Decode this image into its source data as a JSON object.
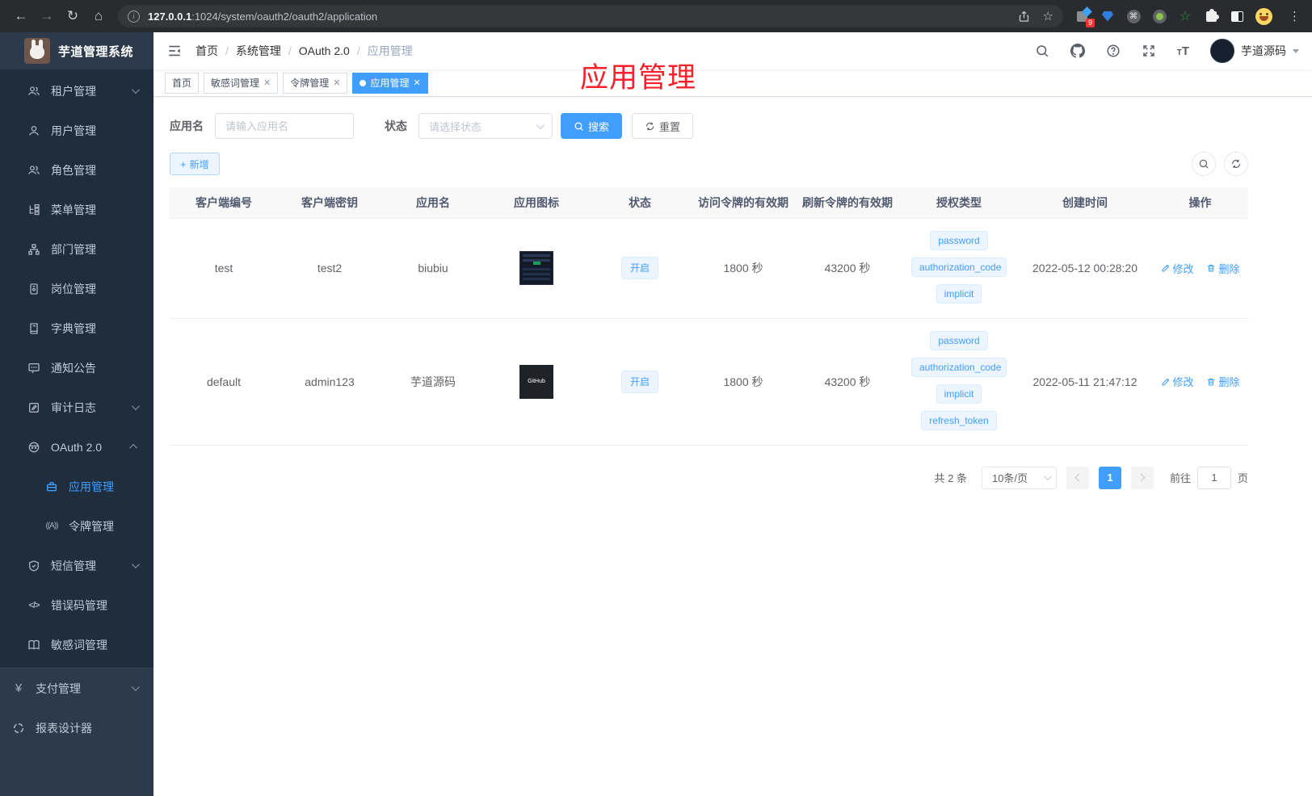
{
  "browser": {
    "url_host": "127.0.0.1",
    "url_path": ":1024/system/oauth2/oauth2/application",
    "ext_badge": "9"
  },
  "sidebar": {
    "logo_title": "芋道管理系统",
    "items": [
      {
        "label": "租户管理",
        "icon": "users-icon",
        "arrow": "down"
      },
      {
        "label": "用户管理",
        "icon": "user-icon"
      },
      {
        "label": "角色管理",
        "icon": "role-users-icon"
      },
      {
        "label": "菜单管理",
        "icon": "menu-tree-icon"
      },
      {
        "label": "部门管理",
        "icon": "org-tree-icon"
      },
      {
        "label": "岗位管理",
        "icon": "post-badge-icon"
      },
      {
        "label": "字典管理",
        "icon": "dictionary-icon"
      },
      {
        "label": "通知公告",
        "icon": "notice-icon"
      },
      {
        "label": "审计日志",
        "icon": "audit-log-icon",
        "arrow": "down"
      },
      {
        "label": "OAuth 2.0",
        "icon": "oauth-robot-icon",
        "arrow": "up"
      },
      {
        "label": "应用管理",
        "icon": "app-briefcase-icon",
        "active": true
      },
      {
        "label": "令牌管理",
        "icon": "token-icon"
      },
      {
        "label": "短信管理",
        "icon": "sms-shield-icon",
        "arrow": "down"
      },
      {
        "label": "错误码管理",
        "icon": "errorcode-icon"
      },
      {
        "label": "敏感词管理",
        "icon": "sensitive-word-icon"
      },
      {
        "label": "支付管理",
        "icon": "pay-yen-icon",
        "arrow": "down"
      },
      {
        "label": "报表设计器",
        "icon": "report-designer-icon"
      }
    ]
  },
  "header": {
    "breadcrumb": [
      "首页",
      "系统管理",
      "OAuth 2.0",
      "应用管理"
    ],
    "breadcrumb_separator": "/",
    "username": "芋道源码"
  },
  "annotation": {
    "text": "应用管理",
    "color": "#f5222d"
  },
  "tabs": [
    {
      "label": "首页",
      "closable": false
    },
    {
      "label": "敏感词管理",
      "closable": true
    },
    {
      "label": "令牌管理",
      "closable": true
    },
    {
      "label": "应用管理",
      "closable": true,
      "active": true
    }
  ],
  "filters": {
    "name_label": "应用名",
    "name_placeholder": "请输入应用名",
    "status_label": "状态",
    "status_placeholder": "请选择状态",
    "search_label": "搜索",
    "reset_label": "重置"
  },
  "toolbar": {
    "add_label": "新增"
  },
  "table": {
    "headers": [
      "客户端编号",
      "客户端密钥",
      "应用名",
      "应用图标",
      "状态",
      "访问令牌的有效期",
      "刷新令牌的有效期",
      "授权类型",
      "创建时间",
      "操作"
    ],
    "rows": [
      {
        "client_id": "test",
        "client_secret": "test2",
        "app_name": "biubiu",
        "icon_kind": "dashboard-screenshot-thumbnail",
        "status": "开启",
        "access_validity": "1800 秒",
        "refresh_validity": "43200 秒",
        "grants": [
          "password",
          "authorization_code",
          "implicit"
        ],
        "created": "2022-05-12 00:28:20"
      },
      {
        "client_id": "default",
        "client_secret": "admin123",
        "app_name": "芋道源码",
        "icon_kind": "github-dark-thumbnail",
        "icon_text": "GitHub",
        "status": "开启",
        "access_validity": "1800 秒",
        "refresh_validity": "43200 秒",
        "grants": [
          "password",
          "authorization_code",
          "implicit",
          "refresh_token"
        ],
        "created": "2022-05-11 21:47:12"
      }
    ]
  },
  "actions": {
    "edit_label": "修改",
    "delete_label": "删除"
  },
  "pagination": {
    "total": "共 2 条",
    "page_size": "10条/页",
    "page": "1",
    "goto_prefix": "前往",
    "goto_page": "1",
    "goto_suffix": "页"
  },
  "colors": {
    "accent": "#409eff",
    "tag_bg": "#ecf5ff",
    "tag_border": "#d9ecff",
    "annotation_red": "#f5222d"
  }
}
